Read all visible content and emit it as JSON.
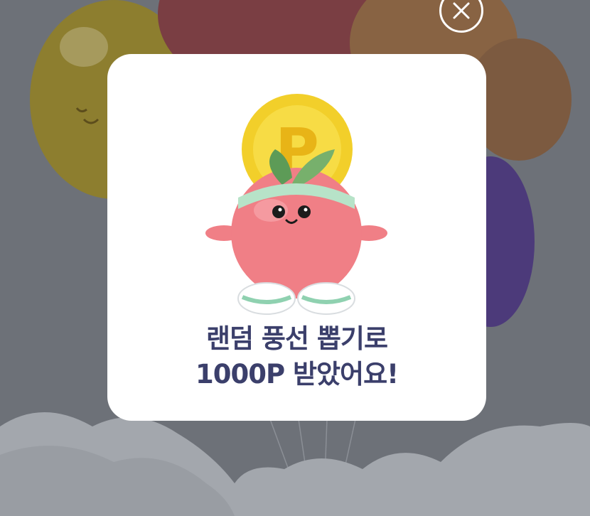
{
  "popup": {
    "message_line1": "랜덤 풍선 뽑기로",
    "message_line2": "1000P 받았어요!",
    "coin_symbol": "P",
    "close_icon": "close-icon"
  },
  "colors": {
    "overlay": "#6d7178",
    "modal_background": "#ffffff",
    "message_text": "#3b3f6b",
    "coin": "#f2cf2a",
    "mascot_body": "#f07f86"
  }
}
